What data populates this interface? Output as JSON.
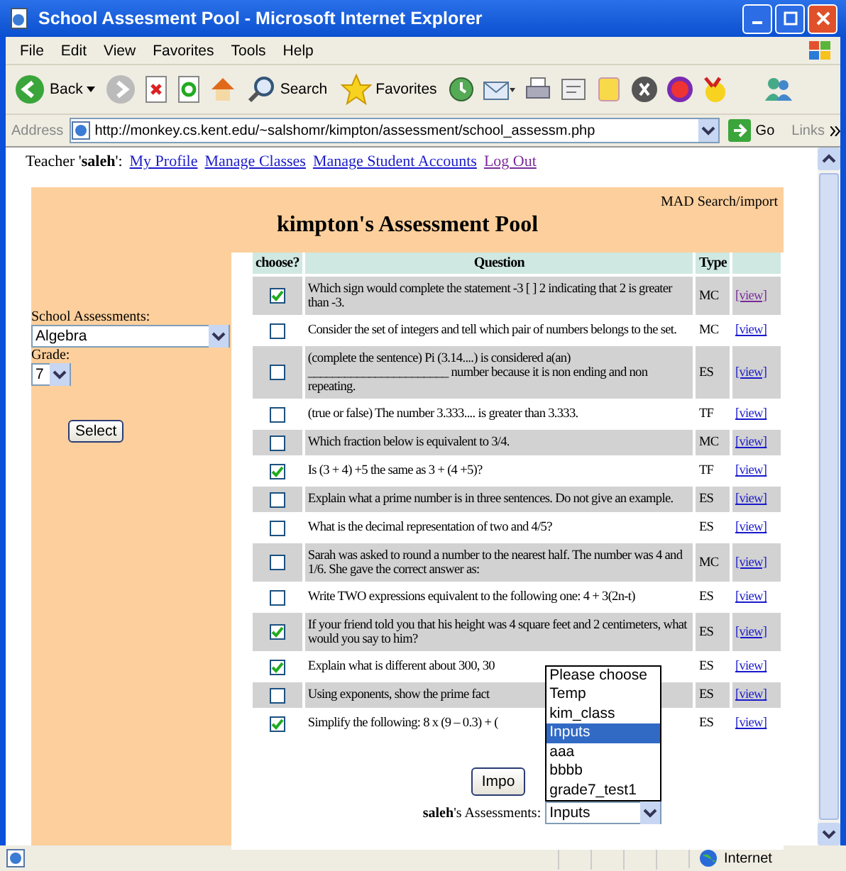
{
  "window": {
    "title": "School Assesment Pool - Microsoft Internet Explorer"
  },
  "menu": [
    "File",
    "Edit",
    "View",
    "Favorites",
    "Tools",
    "Help"
  ],
  "toolbar": {
    "back": "Back",
    "search": "Search",
    "favorites": "Favorites"
  },
  "address": {
    "label": "Address",
    "url": "http://monkey.cs.kent.edu/~salshomr/kimpton/assessment/school_assessm.php",
    "go": "Go",
    "links": "Links"
  },
  "page": {
    "teacher": "Teacher '**saleh**':",
    "links": [
      {
        "label": "My Profile",
        "visited": false
      },
      {
        "label": "Manage Classes",
        "visited": false
      },
      {
        "label": "Manage Student Accounts",
        "visited": false
      },
      {
        "label": "Log Out",
        "visited": true
      }
    ],
    "mad_link": "MAD Search/import",
    "heading": "kimpton's Assessment Pool",
    "sidebar": {
      "assessments_label": "School Assessments:",
      "assessment": "Algebra",
      "grade_label": "Grade:",
      "grade": "7",
      "button": "Select"
    },
    "table": {
      "columns": [
        "choose?",
        "Question",
        "Type"
      ],
      "rows": [
        {
          "checked": true,
          "question": "Which sign would complete the statement -3 [ ] 2 indicating that 2 is greater than -3.",
          "type": "MC",
          "link": "[view]",
          "visited": true
        },
        {
          "checked": false,
          "question": "Consider the set of integers and tell which pair of numbers belongs to the set.",
          "type": "MC",
          "link": "[view]",
          "visited": false
        },
        {
          "checked": false,
          "question": "(complete the sentence) Pi (3.14....) is considered a(an) _______________________ number because it is non ending and non repeating.",
          "type": "ES",
          "link": "[view]",
          "visited": false
        },
        {
          "checked": false,
          "question": "(true or false) The number 3.333.... is greater than 3.333.",
          "type": "TF",
          "link": "[view]",
          "visited": false
        },
        {
          "checked": false,
          "question": "Which fraction below is equivalent to 3/4.",
          "type": "MC",
          "link": "[view]",
          "visited": false
        },
        {
          "checked": true,
          "question": "Is (3 + 4) +5 the same as 3 + (4 +5)?",
          "type": "TF",
          "link": "[view]",
          "visited": false
        },
        {
          "checked": false,
          "question": "Explain what a prime number is in three sentences. Do not give an example.",
          "type": "ES",
          "link": "[view]",
          "visited": false
        },
        {
          "checked": false,
          "question": "What is the decimal representation of two and 4/5?",
          "type": "ES",
          "link": "[view]",
          "visited": false
        },
        {
          "checked": false,
          "question": "Sarah was asked to round a number to the nearest half. The number was 4 and 1/6. She gave the correct answer as:",
          "type": "MC",
          "link": "[view]",
          "visited": false
        },
        {
          "checked": false,
          "question": "Write TWO expressions equivalent to the following one: 4 + 3(2n-t)",
          "type": "ES",
          "link": "[view]",
          "visited": false
        },
        {
          "checked": true,
          "question": "If your friend told you that his height was 4 square feet and 2 centimeters, what would you say to him?",
          "type": "ES",
          "link": "[view]",
          "visited": false
        },
        {
          "checked": true,
          "question": "Explain what is different about 300, 30",
          "type": "ES",
          "link": "[view]",
          "visited": false
        },
        {
          "checked": false,
          "question": "Using exponents, show the prime fact",
          "type": "ES",
          "link": "[view]",
          "visited": false
        },
        {
          "checked": true,
          "question": "Simplify the following: 8 x (9 – 0.3) + (",
          "type": "ES",
          "link": "[view]",
          "visited": false
        }
      ]
    },
    "import_button": "Impo",
    "my_assessments_label": "**saleh**'s Assessments:",
    "my_assessment": "Inputs",
    "options": [
      {
        "label": "Please choose",
        "selected": false
      },
      {
        "label": "Temp",
        "selected": false
      },
      {
        "label": "kim_class",
        "selected": false
      },
      {
        "label": "Inputs",
        "selected": true
      },
      {
        "label": "aaa",
        "selected": false
      },
      {
        "label": "bbbb",
        "selected": false
      },
      {
        "label": "grade7_test1",
        "selected": false
      }
    ]
  },
  "status_bar": {
    "zone": "Internet"
  }
}
